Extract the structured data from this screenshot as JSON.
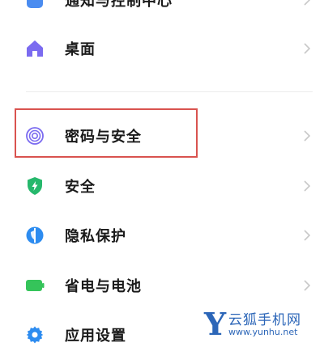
{
  "settings": {
    "items": [
      {
        "label": "通知与控制中心",
        "icon": "notification-icon",
        "color": "#4a8cf0"
      },
      {
        "label": "桌面",
        "icon": "home-icon",
        "color": "#7b6bf0"
      },
      {
        "label": "密码与安全",
        "icon": "fingerprint-icon",
        "color": "#7b6bf0"
      },
      {
        "label": "安全",
        "icon": "shield-icon",
        "color": "#26b86c"
      },
      {
        "label": "隐私保护",
        "icon": "privacy-icon",
        "color": "#2d8cf0"
      },
      {
        "label": "省电与电池",
        "icon": "battery-icon",
        "color": "#35c45a"
      },
      {
        "label": "应用设置",
        "icon": "gear-icon",
        "color": "#2d8cf0"
      }
    ],
    "highlight_color": "#d9534f"
  },
  "watermark": {
    "letter": "Y",
    "name": "云狐手机网",
    "url": "www.yunhu.net"
  }
}
